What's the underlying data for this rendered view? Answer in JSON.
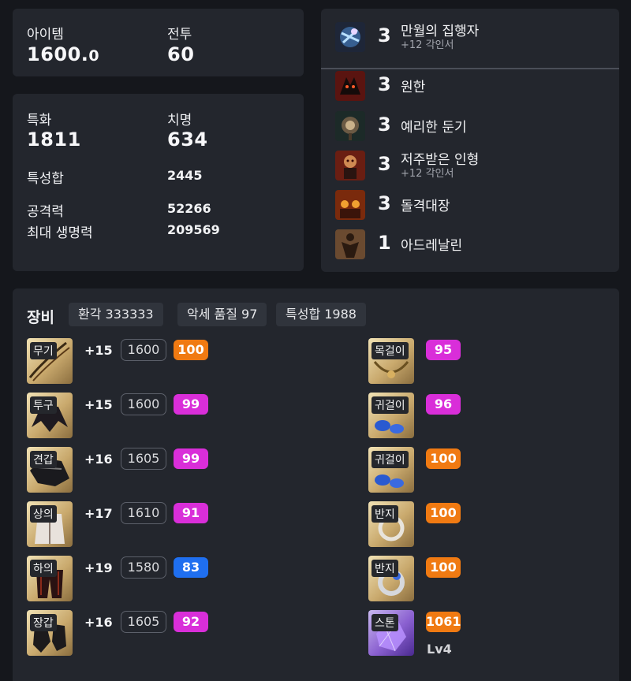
{
  "summary": {
    "item_level_label": "아이템",
    "item_level_int": "1600.",
    "item_level_dec": "0",
    "combat_label": "전투",
    "combat_value": "60"
  },
  "stats": {
    "spec_label": "특화",
    "spec_value": "1811",
    "crit_label": "치명",
    "crit_value": "634",
    "total_label": "특성합",
    "total_value": "2445",
    "atk_label": "공격력",
    "atk_value": "52266",
    "hp_label": "최대 생명력",
    "hp_value": "209569"
  },
  "engravings": [
    {
      "level": "3",
      "name": "만월의 집행자",
      "sub": "+12 각인서",
      "icon": "moon-executioner-icon"
    },
    {
      "level": "3",
      "name": "원한",
      "sub": "",
      "icon": "grudge-icon"
    },
    {
      "level": "3",
      "name": "예리한 둔기",
      "sub": "",
      "icon": "keen-blunt-weapon-icon"
    },
    {
      "level": "3",
      "name": "저주받은 인형",
      "sub": "+12 각인서",
      "icon": "cursed-doll-icon"
    },
    {
      "level": "3",
      "name": "돌격대장",
      "sub": "",
      "icon": "raid-captain-icon"
    },
    {
      "level": "1",
      "name": "아드레날린",
      "sub": "",
      "icon": "adrenaline-icon"
    }
  ],
  "equipment": {
    "title": "장비",
    "chips": [
      "환각 333333",
      "악세 품질 97",
      "특성합 1988"
    ],
    "left": [
      {
        "slot": "무기",
        "enhance": "+15",
        "item_level": "1600",
        "quality": "100",
        "quality_color": "orange",
        "icon": "weapon-icon"
      },
      {
        "slot": "투구",
        "enhance": "+15",
        "item_level": "1600",
        "quality": "99",
        "quality_color": "magenta",
        "icon": "helmet-icon"
      },
      {
        "slot": "견갑",
        "enhance": "+16",
        "item_level": "1605",
        "quality": "99",
        "quality_color": "magenta",
        "icon": "shoulder-icon"
      },
      {
        "slot": "상의",
        "enhance": "+17",
        "item_level": "1610",
        "quality": "91",
        "quality_color": "magenta",
        "icon": "chest-icon"
      },
      {
        "slot": "하의",
        "enhance": "+19",
        "item_level": "1580",
        "quality": "83",
        "quality_color": "blue",
        "icon": "pants-icon"
      },
      {
        "slot": "장갑",
        "enhance": "+16",
        "item_level": "1605",
        "quality": "92",
        "quality_color": "magenta",
        "icon": "gloves-icon"
      }
    ],
    "right": [
      {
        "slot": "목걸이",
        "quality": "95",
        "quality_color": "magenta",
        "icon": "necklace-icon"
      },
      {
        "slot": "귀걸이",
        "quality": "96",
        "quality_color": "magenta",
        "icon": "earring-icon"
      },
      {
        "slot": "귀걸이",
        "quality": "100",
        "quality_color": "orange",
        "icon": "earring-icon"
      },
      {
        "slot": "반지",
        "quality": "100",
        "quality_color": "orange",
        "icon": "ring-icon"
      },
      {
        "slot": "반지",
        "quality": "100",
        "quality_color": "orange",
        "icon": "ring-icon"
      },
      {
        "slot": "스톤",
        "quality": "1061",
        "quality_color": "orange",
        "extra": "Lv4",
        "icon": "stone-icon"
      }
    ]
  },
  "colors": {
    "orange": "#f07a12",
    "magenta": "#d92ed9",
    "blue": "#1f6ff0"
  }
}
